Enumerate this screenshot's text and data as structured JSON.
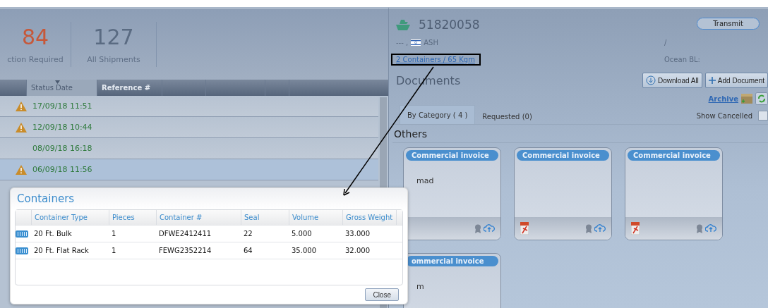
{
  "stats": [
    {
      "value": "84",
      "label": "ction Required",
      "kind": "alert"
    },
    {
      "value": "127",
      "label": "All Shipments",
      "kind": "normal"
    }
  ],
  "grid": {
    "columns": [
      {
        "label": "Status Date",
        "selected": true
      },
      {
        "label": "Reference #",
        "selected": false
      }
    ],
    "rows": [
      {
        "status_date": "17/09/18 11:51",
        "warning": true,
        "selected": false
      },
      {
        "status_date": "12/09/18 10:44",
        "warning": true,
        "selected": false
      },
      {
        "status_date": "08/09/18 16:18",
        "warning": false,
        "selected": false
      },
      {
        "status_date": "06/09/18 11:56",
        "warning": true,
        "selected": true
      }
    ]
  },
  "shipment": {
    "number": "51820058",
    "transmit": "Transmit",
    "origin": "--- ,",
    "port": "ASH",
    "slash": "/",
    "ocean_bl": "Ocean BL:",
    "containers_link": "2 Containers / 65 Kgm"
  },
  "documents": {
    "title": "Documents",
    "buttons": [
      "Download All",
      "Add Document"
    ],
    "archive": "Archive",
    "tabs": [
      {
        "label": "By Category ( 4 )",
        "selected": true
      },
      {
        "label": "Requested (0)",
        "selected": false
      }
    ],
    "show_cancelled": {
      "label": "Show Cancelled",
      "checked": false
    },
    "section": "Others",
    "cards": [
      {
        "title": "Commercial invoice",
        "text": "mad",
        "footer": true,
        "pdf": false
      },
      {
        "title": "Commercial invoice",
        "footer": true,
        "pdf": true
      },
      {
        "title": "Commercial invoice",
        "footer": true,
        "pdf": true
      },
      {
        "title": "ommercial invoice",
        "text": "m"
      }
    ]
  },
  "dialog": {
    "title": "Containers",
    "columns": [
      "Container Type",
      "Pieces",
      "Container #",
      "Seal",
      "Volume",
      "Gross Weight"
    ],
    "rows": [
      [
        "20 Ft. Bulk",
        "1",
        "DFWE2412411",
        "22",
        "5.000",
        "33.000"
      ],
      [
        "20 Ft. Flat Rack",
        "1",
        "FEWG2352214",
        "64",
        "35.000",
        "32.000"
      ]
    ],
    "close": "Close"
  }
}
